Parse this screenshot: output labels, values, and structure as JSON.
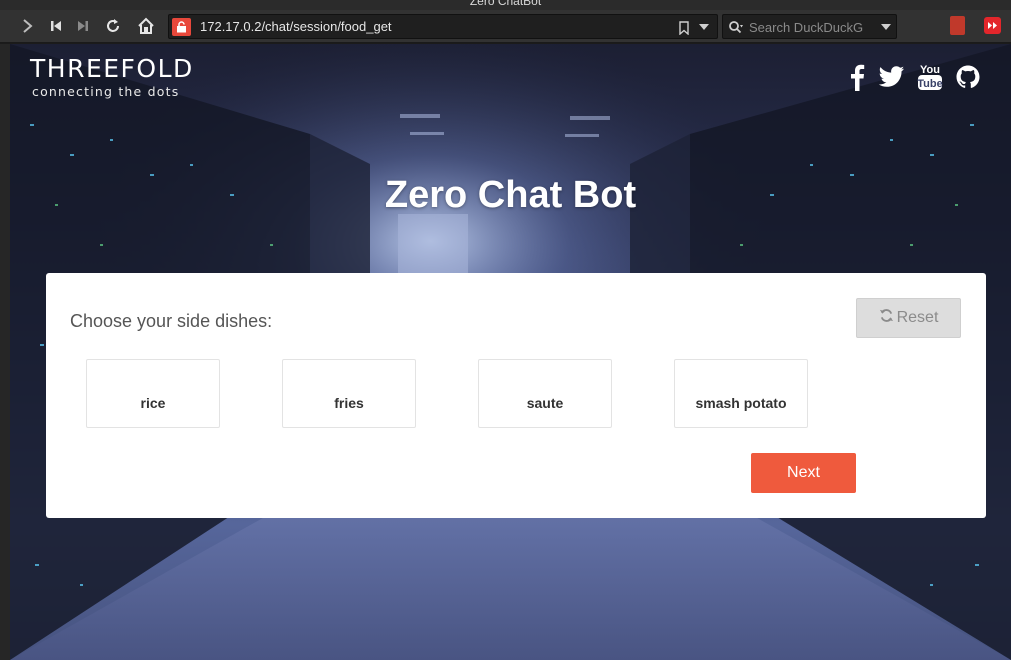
{
  "window": {
    "title": "Zero ChatBot"
  },
  "browser": {
    "url": "172.17.0.2/chat/session/food_get",
    "search_placeholder": "Search DuckDuckGo",
    "icons": {
      "forward": "chevron-right-icon",
      "skip_back": "skip-back-icon",
      "skip_forward": "skip-forward-icon",
      "reload": "reload-icon",
      "home": "home-icon",
      "lock": "insecure-lock-icon",
      "bookmark": "bookmark-icon",
      "search": "search-icon"
    }
  },
  "site": {
    "logo_title": "THREEFOLD",
    "logo_tagline": "connecting the dots",
    "social": [
      "facebook-icon",
      "twitter-icon",
      "youtube-icon",
      "github-icon"
    ],
    "hero_title": "Zero Chat Bot"
  },
  "form": {
    "question": "Choose your side dishes:",
    "reset_label": "Reset",
    "options": [
      "rice",
      "fries",
      "saute",
      "smash potato"
    ],
    "next_label": "Next"
  },
  "colors": {
    "accent": "#ef5a3d",
    "reset_bg": "#dddddd",
    "lock_red": "#e8483b"
  }
}
